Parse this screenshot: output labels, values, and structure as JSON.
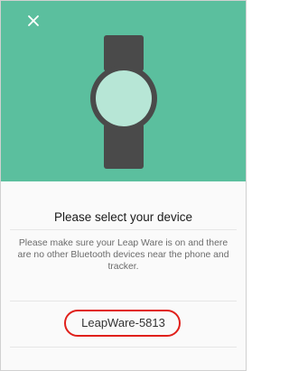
{
  "header": {
    "background_color": "#5bbf9e",
    "close_icon": "close-icon"
  },
  "illustration": {
    "icon": "smartwatch-icon",
    "face_color": "#b7e6d6",
    "band_color": "#4a4a4a"
  },
  "sheet": {
    "title": "Please select your device",
    "description": "Please make sure your Leap Ware is on and there are no other Bluetooth devices near the phone and tracker."
  },
  "devices": [
    {
      "name": "LeapWare-5813"
    }
  ],
  "colors": {
    "accent": "#5bbf9e",
    "highlight": "#e0201b"
  }
}
